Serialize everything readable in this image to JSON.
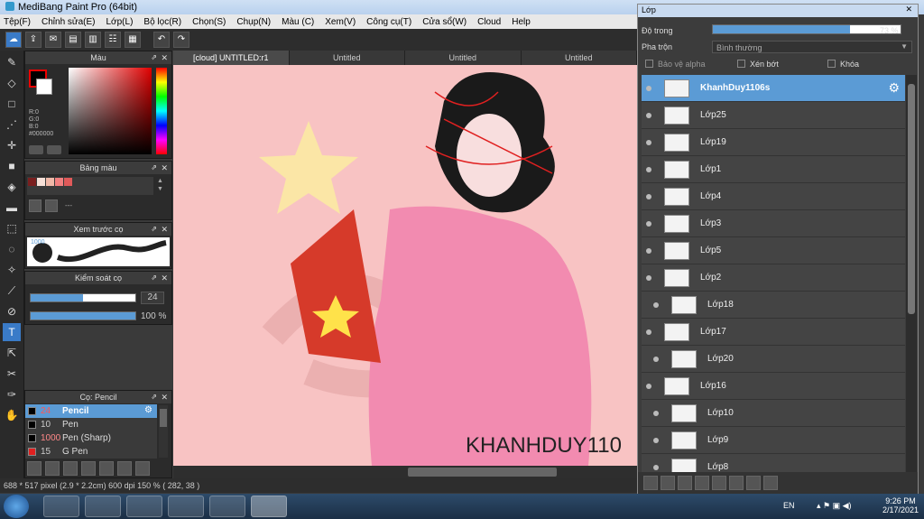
{
  "window_title": "MediBang Paint Pro (64bit)",
  "menu": [
    "Tệp(F)",
    "Chỉnh sửa(E)",
    "Lớp(L)",
    "Bộ lọc(R)",
    "Chọn(S)",
    "Chụp(N)",
    "Màu (C)",
    "Xem(V)",
    "Công cụ(T)",
    "Cửa sổ(W)",
    "Cloud",
    "Help"
  ],
  "color_panel": {
    "title": "Màu",
    "r": "R:0",
    "g": "G:0",
    "b": "B:0",
    "hex": "#000000"
  },
  "palette_panel": {
    "title": "Bảng màu",
    "dash": "---"
  },
  "brush_preview": {
    "title": "Xem trước cọ",
    "size": "1000"
  },
  "brush_control": {
    "title": "Kiểm soát cọ",
    "size": "24",
    "opacity": "100 %"
  },
  "brush_list": {
    "title": "Cọ: Pencil",
    "items": [
      {
        "size": "24",
        "name": "Pencil",
        "color": "#000000",
        "selected": true
      },
      {
        "size": "10",
        "name": "Pen",
        "color": "#000000",
        "selected": false
      },
      {
        "size": "1000",
        "name": "Pen (Sharp)",
        "color": "#000000",
        "selected": false
      },
      {
        "size": "15",
        "name": "G Pen",
        "color": "#e02020",
        "selected": false
      }
    ]
  },
  "tabs": [
    "[cloud] UNTITLED:r1",
    "Untitled",
    "Untitled",
    "Untitled"
  ],
  "artwork": {
    "signature": "KHANHDUY110"
  },
  "status": {
    "dims": "688 * 517 pixel",
    "cm": "(2.9 * 2.2cm)",
    "dpi": "600 dpi",
    "zoom": "150 %",
    "coord": "( 282, 38 )"
  },
  "layer_window": {
    "title": "Lớp",
    "opacity_label": "Độ trong",
    "opacity_value": "73 %",
    "opacity_fraction": 0.73,
    "blend_label": "Pha trộn",
    "blend_value": "Bình thường",
    "protect_alpha": "Bảo vệ alpha",
    "clipping": "Xén bớt",
    "lock": "Khóa",
    "layers": [
      {
        "name": "KhanhDuy1106s",
        "selected": true,
        "indent": 0
      },
      {
        "name": "Lớp25",
        "selected": false,
        "indent": 0
      },
      {
        "name": "Lớp19",
        "selected": false,
        "indent": 0
      },
      {
        "name": "Lớp1",
        "selected": false,
        "indent": 0
      },
      {
        "name": "Lớp4",
        "selected": false,
        "indent": 0
      },
      {
        "name": "Lớp3",
        "selected": false,
        "indent": 0
      },
      {
        "name": "Lớp5",
        "selected": false,
        "indent": 0
      },
      {
        "name": "Lớp2",
        "selected": false,
        "indent": 0
      },
      {
        "name": "Lớp18",
        "selected": false,
        "indent": 1
      },
      {
        "name": "Lớp17",
        "selected": false,
        "indent": 0
      },
      {
        "name": "Lớp20",
        "selected": false,
        "indent": 1
      },
      {
        "name": "Lớp16",
        "selected": false,
        "indent": 0
      },
      {
        "name": "Lớp10",
        "selected": false,
        "indent": 1
      },
      {
        "name": "Lớp9",
        "selected": false,
        "indent": 1
      },
      {
        "name": "Lớp8",
        "selected": false,
        "indent": 1
      }
    ]
  },
  "taskbar": {
    "lang": "EN",
    "time": "9:26 PM",
    "date": "2/17/2021"
  }
}
